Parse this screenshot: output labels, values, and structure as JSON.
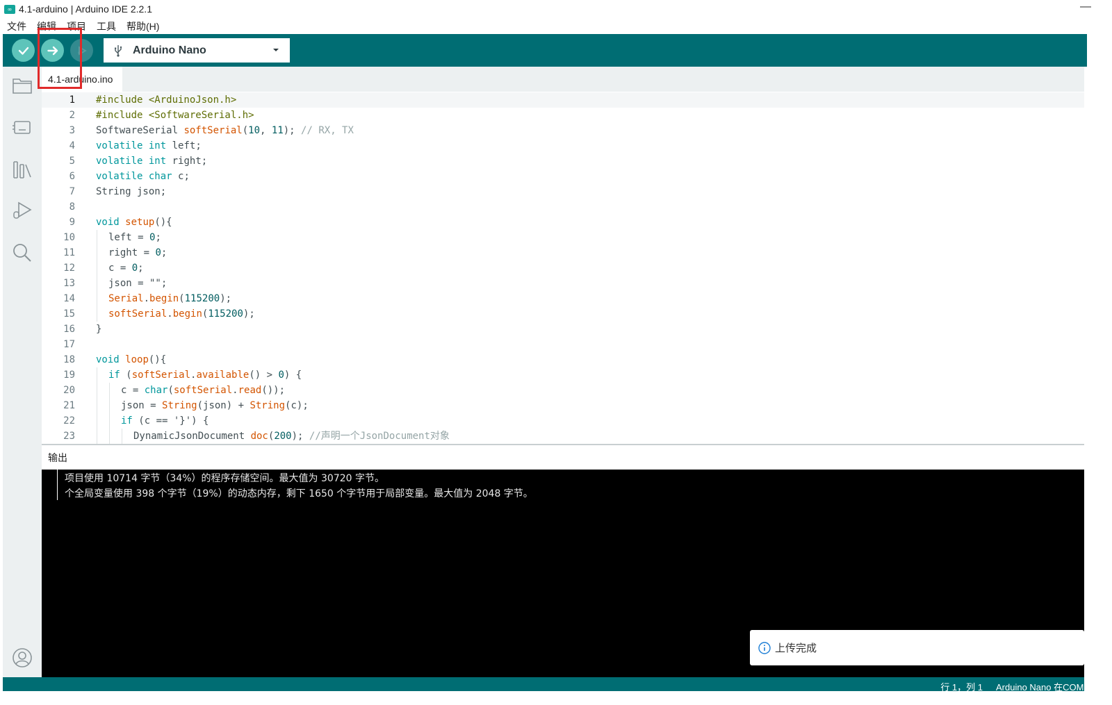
{
  "window": {
    "title": "4.1-arduino | Arduino IDE 2.2.1",
    "app_icon": "∞",
    "minimize_glyph": "—"
  },
  "menu": [
    "文件",
    "编辑",
    "项目",
    "工具",
    "帮助(H)"
  ],
  "toolbar": {
    "board": "Arduino Nano",
    "icons": [
      "verify-icon",
      "upload-icon",
      "debug-icon",
      "usb-icon",
      "chevron-down-icon"
    ]
  },
  "tab": {
    "label": "4.1-arduino.ino"
  },
  "editor": {
    "active_line": 1,
    "lines": [
      {
        "n": "1",
        "indent": 0,
        "tokens": [
          [
            "pp",
            "#include <ArduinoJson.h>"
          ]
        ]
      },
      {
        "n": "2",
        "indent": 0,
        "tokens": [
          [
            "pp",
            "#include <SoftwareSerial.h>"
          ]
        ]
      },
      {
        "n": "3",
        "indent": 0,
        "tokens": [
          [
            "",
            "SoftwareSerial "
          ],
          [
            "fn",
            "softSerial"
          ],
          [
            "",
            "("
          ],
          [
            "num",
            "10"
          ],
          [
            "",
            ", "
          ],
          [
            "num",
            "11"
          ],
          [
            "",
            "); "
          ],
          [
            "cm",
            "// RX, TX"
          ]
        ]
      },
      {
        "n": "4",
        "indent": 0,
        "tokens": [
          [
            "kw",
            "volatile"
          ],
          [
            "",
            " "
          ],
          [
            "kw",
            "int"
          ],
          [
            "",
            " left;"
          ]
        ]
      },
      {
        "n": "5",
        "indent": 0,
        "tokens": [
          [
            "kw",
            "volatile"
          ],
          [
            "",
            " "
          ],
          [
            "kw",
            "int"
          ],
          [
            "",
            " right;"
          ]
        ]
      },
      {
        "n": "6",
        "indent": 0,
        "tokens": [
          [
            "kw",
            "volatile"
          ],
          [
            "",
            " "
          ],
          [
            "kw",
            "char"
          ],
          [
            "",
            " c;"
          ]
        ]
      },
      {
        "n": "7",
        "indent": 0,
        "tokens": [
          [
            "",
            "String json;"
          ]
        ]
      },
      {
        "n": "8",
        "indent": 0,
        "tokens": []
      },
      {
        "n": "9",
        "indent": 0,
        "tokens": [
          [
            "kw",
            "void"
          ],
          [
            "",
            " "
          ],
          [
            "fn",
            "setup"
          ],
          [
            "",
            "(){"
          ]
        ]
      },
      {
        "n": "10",
        "indent": 1,
        "tokens": [
          [
            "",
            "left = "
          ],
          [
            "num",
            "0"
          ],
          [
            "",
            ";"
          ]
        ]
      },
      {
        "n": "11",
        "indent": 1,
        "tokens": [
          [
            "",
            "right = "
          ],
          [
            "num",
            "0"
          ],
          [
            "",
            ";"
          ]
        ]
      },
      {
        "n": "12",
        "indent": 1,
        "tokens": [
          [
            "",
            "c = "
          ],
          [
            "num",
            "0"
          ],
          [
            "",
            ";"
          ]
        ]
      },
      {
        "n": "13",
        "indent": 1,
        "tokens": [
          [
            "",
            "json = \"\";"
          ]
        ]
      },
      {
        "n": "14",
        "indent": 1,
        "tokens": [
          [
            "fn",
            "Serial"
          ],
          [
            "",
            "."
          ],
          [
            "fn",
            "begin"
          ],
          [
            "",
            "("
          ],
          [
            "num",
            "115200"
          ],
          [
            "",
            ");"
          ]
        ]
      },
      {
        "n": "15",
        "indent": 1,
        "tokens": [
          [
            "fn",
            "softSerial"
          ],
          [
            "",
            "."
          ],
          [
            "fn",
            "begin"
          ],
          [
            "",
            "("
          ],
          [
            "num",
            "115200"
          ],
          [
            "",
            ");"
          ]
        ]
      },
      {
        "n": "16",
        "indent": 0,
        "tokens": [
          [
            "",
            "}"
          ]
        ]
      },
      {
        "n": "17",
        "indent": 0,
        "tokens": []
      },
      {
        "n": "18",
        "indent": 0,
        "tokens": [
          [
            "kw",
            "void"
          ],
          [
            "",
            " "
          ],
          [
            "fn",
            "loop"
          ],
          [
            "",
            "(){"
          ]
        ]
      },
      {
        "n": "19",
        "indent": 1,
        "tokens": [
          [
            "kw",
            "if"
          ],
          [
            "",
            " ("
          ],
          [
            "fn",
            "softSerial"
          ],
          [
            "",
            "."
          ],
          [
            "fn",
            "available"
          ],
          [
            "",
            "() > "
          ],
          [
            "num",
            "0"
          ],
          [
            "",
            ") {"
          ]
        ]
      },
      {
        "n": "20",
        "indent": 2,
        "tokens": [
          [
            "",
            "c = "
          ],
          [
            "kw",
            "char"
          ],
          [
            "",
            "("
          ],
          [
            "fn",
            "softSerial"
          ],
          [
            "",
            "."
          ],
          [
            "fn",
            "read"
          ],
          [
            "",
            "());"
          ]
        ]
      },
      {
        "n": "21",
        "indent": 2,
        "tokens": [
          [
            "",
            "json = "
          ],
          [
            "fn",
            "String"
          ],
          [
            "",
            "(json) + "
          ],
          [
            "fn",
            "String"
          ],
          [
            "",
            "(c);"
          ]
        ]
      },
      {
        "n": "22",
        "indent": 2,
        "tokens": [
          [
            "kw",
            "if"
          ],
          [
            "",
            " (c == '}') {"
          ]
        ]
      },
      {
        "n": "23",
        "indent": 3,
        "tokens": [
          [
            "",
            "DynamicJsonDocument "
          ],
          [
            "fn",
            "doc"
          ],
          [
            "",
            "("
          ],
          [
            "num",
            "200"
          ],
          [
            "",
            "); "
          ],
          [
            "cm",
            "//声明一个JsonDocument对象"
          ]
        ]
      }
    ]
  },
  "output": {
    "header": "输出",
    "lines": [
      "项目使用 10714 字节（34%）的程序存储空间。最大值为 30720 字节。",
      "个全局变量使用 398 个字节（19%）的动态内存，剩下 1650 个字节用于局部变量。最大值为 2048 字节。"
    ]
  },
  "notification": {
    "text": "上传完成",
    "icon": "info-icon"
  },
  "status": {
    "position": "行 1，列 1",
    "board_port": "Arduino Nano 在COM"
  },
  "colors": {
    "toolbar": "#006d73",
    "button_active": "#5ec4ba",
    "highlight": "#e02a2a"
  }
}
